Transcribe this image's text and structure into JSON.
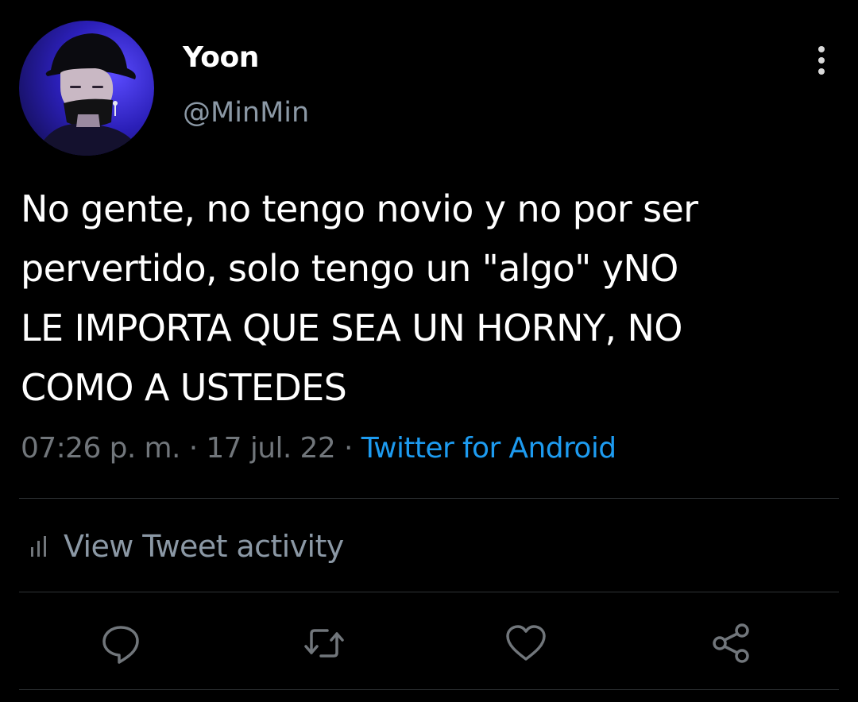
{
  "tweet": {
    "display_name": "Yoon",
    "handle": "@MinMin",
    "text": "No gente, no tengo novio y no por ser\npervertido, solo tengo un \"algo\" yNO\nLE IMPORTA QUE SEA UN HORNY, NO\nCOMO A USTEDES",
    "time": "07:26 p. m.",
    "separator": "·",
    "date": "17 jul. 22",
    "source": "Twitter for Android"
  },
  "activity": {
    "label": "View Tweet activity",
    "icon": "bar-chart-icon"
  },
  "actions": [
    {
      "name": "reply",
      "icon": "reply-icon"
    },
    {
      "name": "retweet",
      "icon": "retweet-icon"
    },
    {
      "name": "like",
      "icon": "heart-icon"
    },
    {
      "name": "share",
      "icon": "share-icon"
    }
  ],
  "colors": {
    "background": "#000000",
    "text_primary": "#ffffff",
    "text_secondary": "#71767b",
    "link": "#1d9bf0",
    "divider": "#2f3336"
  }
}
